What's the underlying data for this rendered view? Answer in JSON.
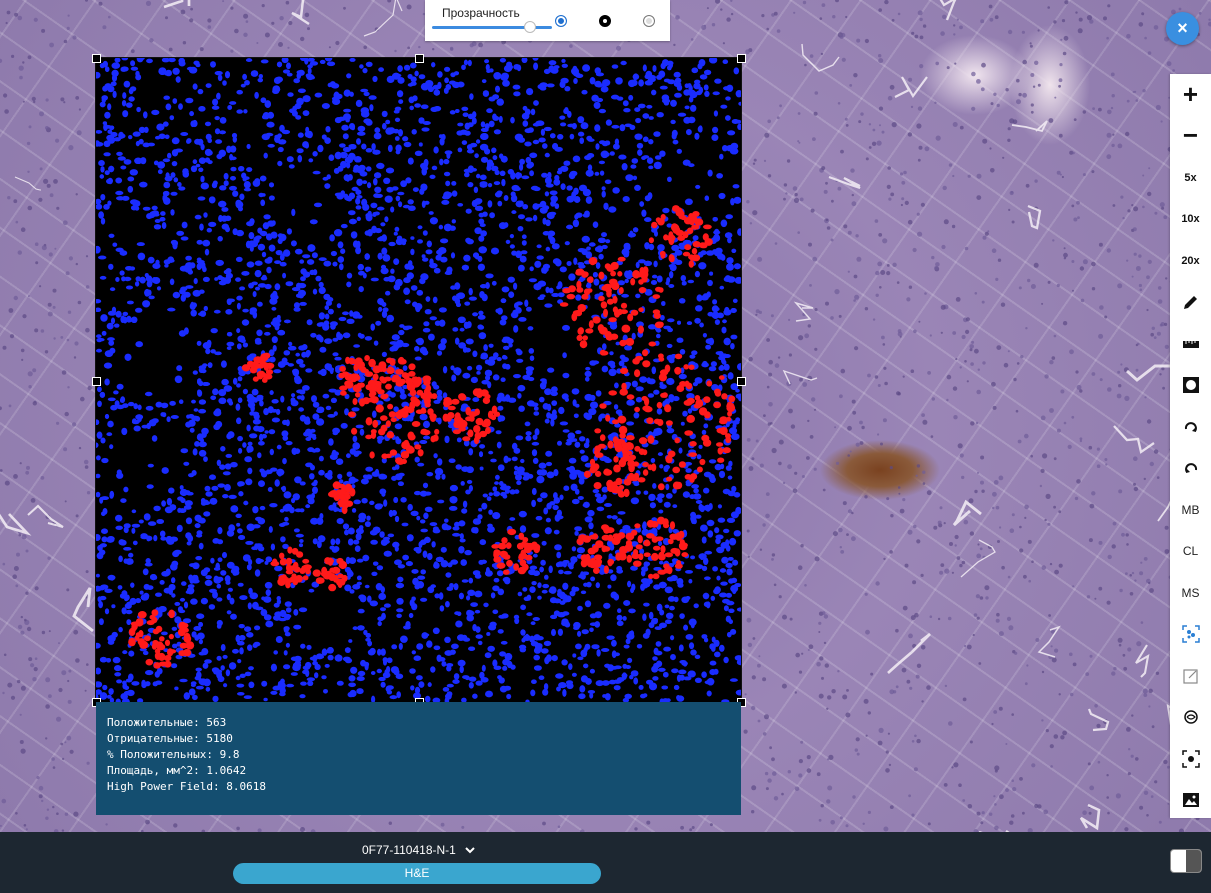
{
  "opacity_panel": {
    "label": "Прозрачность",
    "level": 0.85
  },
  "close_button": {
    "glyph": "×"
  },
  "stats": {
    "lines": [
      "Положительные: 563",
      "Отрицательные: 5180",
      "% Положительных: 9.8",
      "Площадь, мм^2: 1.0642",
      "High Power Field: 8.0618"
    ]
  },
  "toolbar": {
    "zoom_in": "+",
    "zoom_out": "−",
    "mag_5": "5x",
    "mag_10": "10x",
    "mag_20": "20x",
    "mb": "MB",
    "cl": "CL",
    "ms": "MS"
  },
  "bottom_bar": {
    "slide_id": "0F77-110418-N-1",
    "stain": "H&E"
  },
  "colors": {
    "positive": "#ff1a1a",
    "negative": "#1a2cff",
    "accent": "#3a8fe0",
    "stats_bg": "#144e70",
    "bottom_bg": "#1d2731"
  }
}
